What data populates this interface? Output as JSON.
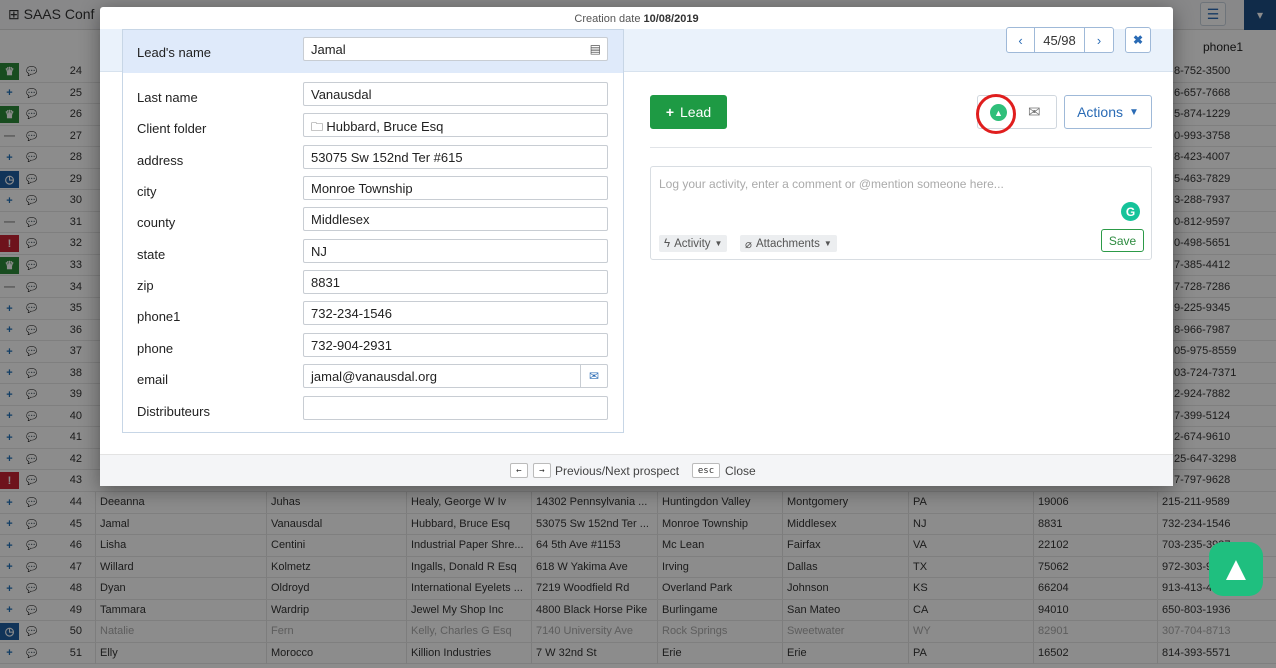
{
  "app": {
    "title": "SAAS Conf"
  },
  "table": {
    "phone_header": "phone1",
    "rows": [
      {
        "num": "24",
        "icon": "trophy",
        "phone": "8-752-3500"
      },
      {
        "num": "25",
        "icon": "plus",
        "phone": "6-657-7668"
      },
      {
        "num": "26",
        "icon": "trophy",
        "phone": "5-874-1229"
      },
      {
        "num": "27",
        "icon": "minus",
        "phone": "0-993-3758"
      },
      {
        "num": "28",
        "icon": "plus",
        "phone": "8-423-4007"
      },
      {
        "num": "29",
        "icon": "clock",
        "phone": "5-463-7829"
      },
      {
        "num": "30",
        "icon": "plus",
        "phone": "3-288-7937"
      },
      {
        "num": "31",
        "icon": "minus",
        "phone": "0-812-9597"
      },
      {
        "num": "32",
        "icon": "alert",
        "phone": "0-498-5651"
      },
      {
        "num": "33",
        "icon": "trophy",
        "phone": "7-385-4412"
      },
      {
        "num": "34",
        "icon": "minus",
        "phone": "7-728-7286"
      },
      {
        "num": "35",
        "icon": "plus",
        "phone": "9-225-9345"
      },
      {
        "num": "36",
        "icon": "plus",
        "phone": "8-966-7987"
      },
      {
        "num": "37",
        "icon": "plus",
        "phone": "05-975-8559"
      },
      {
        "num": "38",
        "icon": "plus",
        "phone": "03-724-7371"
      },
      {
        "num": "39",
        "icon": "plus",
        "phone": "2-924-7882"
      },
      {
        "num": "40",
        "icon": "plus",
        "phone": "7-399-5124"
      },
      {
        "num": "41",
        "icon": "plus",
        "phone": "2-674-9610"
      },
      {
        "num": "42",
        "icon": "plus",
        "phone": "25-647-3298"
      },
      {
        "num": "43",
        "icon": "alert",
        "phone": "7-797-9628"
      }
    ],
    "full_rows": [
      {
        "num": "44",
        "icon": "plus",
        "first": "Deeanna",
        "last": "Juhas",
        "company": "Healy, George W Iv",
        "address": "14302 Pennsylvania ...",
        "city": "Huntingdon Valley",
        "county": "Montgomery",
        "state": "PA",
        "zip": "19006",
        "phone": "215-211-9589",
        "faded": false
      },
      {
        "num": "45",
        "icon": "plus",
        "first": "Jamal",
        "last": "Vanausdal",
        "company": "Hubbard, Bruce Esq",
        "address": "53075 Sw 152nd Ter ...",
        "city": "Monroe Township",
        "county": "Middlesex",
        "state": "NJ",
        "zip": "8831",
        "phone": "732-234-1546",
        "faded": false
      },
      {
        "num": "46",
        "icon": "plus",
        "first": "Lisha",
        "last": "Centini",
        "company": "Industrial Paper Shre...",
        "address": "64 5th Ave #1153",
        "city": "Mc Lean",
        "county": "Fairfax",
        "state": "VA",
        "zip": "22102",
        "phone": "703-235-3937",
        "faded": false
      },
      {
        "num": "47",
        "icon": "plus",
        "first": "Willard",
        "last": "Kolmetz",
        "company": "Ingalls, Donald R Esq",
        "address": "618 W Yakima Ave",
        "city": "Irving",
        "county": "Dallas",
        "state": "TX",
        "zip": "75062",
        "phone": "972-303-9197",
        "faded": false
      },
      {
        "num": "48",
        "icon": "plus",
        "first": "Dyan",
        "last": "Oldroyd",
        "company": "International Eyelets ...",
        "address": "7219 Woodfield Rd",
        "city": "Overland Park",
        "county": "Johnson",
        "state": "KS",
        "zip": "66204",
        "phone": "913-413-4604",
        "faded": false
      },
      {
        "num": "49",
        "icon": "plus",
        "first": "Tammara",
        "last": "Wardrip",
        "company": "Jewel My Shop Inc",
        "address": "4800 Black Horse Pike",
        "city": "Burlingame",
        "county": "San Mateo",
        "state": "CA",
        "zip": "94010",
        "phone": "650-803-1936",
        "faded": false
      },
      {
        "num": "50",
        "icon": "clock",
        "first": "Natalie",
        "last": "Fern",
        "company": "Kelly, Charles G Esq",
        "address": "7140 University Ave",
        "city": "Rock Springs",
        "county": "Sweetwater",
        "state": "WY",
        "zip": "82901",
        "phone": "307-704-8713",
        "faded": true
      },
      {
        "num": "51",
        "icon": "plus",
        "first": "Elly",
        "last": "Morocco",
        "company": "Killion Industries",
        "address": "7 W 32nd St",
        "city": "Erie",
        "county": "Erie",
        "state": "PA",
        "zip": "16502",
        "phone": "814-393-5571",
        "faded": false
      }
    ]
  },
  "modal": {
    "creation_label": "Creation date",
    "creation_date": "10/08/2019",
    "pager": "45/98",
    "fields": [
      {
        "label": "Lead's name",
        "value": "Jamal",
        "icon": "id-card-icon"
      },
      {
        "label": "Last name",
        "value": "Vanausdal"
      },
      {
        "label": "Client folder",
        "value": "Hubbard, Bruce Esq",
        "prefix": "folder-icon"
      },
      {
        "label": "address",
        "value": "53075 Sw 152nd Ter #615"
      },
      {
        "label": "city",
        "value": "Monroe Township"
      },
      {
        "label": "county",
        "value": "Middlesex"
      },
      {
        "label": "state",
        "value": "NJ"
      },
      {
        "label": "zip",
        "value": "8831"
      },
      {
        "label": "phone1",
        "value": "732-234-1546"
      },
      {
        "label": "phone",
        "value": "732-904-2931"
      },
      {
        "label": "email",
        "value": "jamal@vanausdal.org",
        "icon": "mail-icon"
      },
      {
        "label": "Distributeurs",
        "value": ""
      }
    ],
    "lead_button": "Lead",
    "actions_button": "Actions",
    "activity_placeholder": "Log your activity, enter a comment or @mention someone here...",
    "activity_chip": "Activity",
    "attachments_chip": "Attachments",
    "save_button": "Save",
    "footer": {
      "key_prev": "←",
      "key_next": "→",
      "nav_text": "Previous/Next prospect",
      "key_esc": "esc",
      "close_text": "Close"
    }
  },
  "colors": {
    "green": "#1e9a44",
    "blue": "#2a6bb5",
    "highlight_circle": "#e01e1e",
    "app_green": "#1fbf7f"
  }
}
